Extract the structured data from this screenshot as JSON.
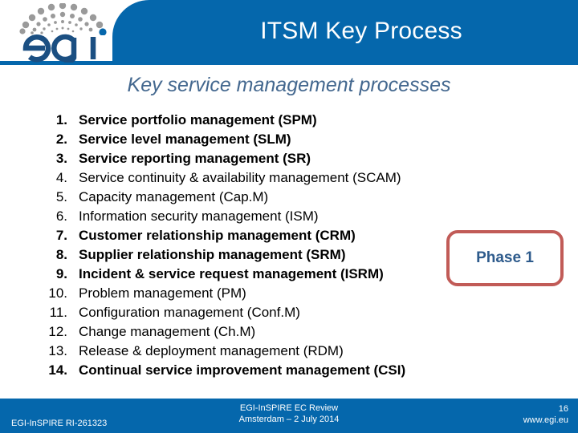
{
  "header": {
    "title": "ITSM Key Process",
    "logo_alt": "EGI",
    "logo_wordmark": "egi",
    "bar_color": "#0567ac"
  },
  "subtitle": "Key service management processes",
  "list": {
    "items": [
      {
        "num": "1.",
        "label": "Service portfolio management (SPM)",
        "bold": true
      },
      {
        "num": "2.",
        "label": "Service level management (SLM)",
        "bold": true
      },
      {
        "num": "3.",
        "label": "Service reporting management (SR)",
        "bold": true
      },
      {
        "num": "4.",
        "label": "Service continuity & availability management (SCAM)",
        "bold": false
      },
      {
        "num": "5.",
        "label": "Capacity management (Cap.M)",
        "bold": false
      },
      {
        "num": "6.",
        "label": "Information security management (ISM)",
        "bold": false
      },
      {
        "num": "7.",
        "label": "Customer relationship management (CRM)",
        "bold": true
      },
      {
        "num": "8.",
        "label": "Supplier relationship management (SRM)",
        "bold": true
      },
      {
        "num": "9.",
        "label": "Incident & service request management (ISRM)",
        "bold": true
      },
      {
        "num": "10.",
        "label": "Problem management (PM)",
        "bold": false
      },
      {
        "num": "11.",
        "label": "Configuration management (Conf.M)",
        "bold": false
      },
      {
        "num": "12.",
        "label": "Change management (Ch.M)",
        "bold": false
      },
      {
        "num": "13.",
        "label": "Release & deployment management (RDM)",
        "bold": false
      },
      {
        "num": "14.",
        "label": "Continual service improvement management (CSI)",
        "bold": true
      }
    ]
  },
  "phase_badge": {
    "label": "Phase 1",
    "border_color": "#c15b57",
    "text_color": "#2e5b8c"
  },
  "footer": {
    "left": "EGI-InSPIRE RI-261323",
    "center_line1": "EGI-InSPIRE EC Review",
    "center_line2": "Amsterdam – 2 July 2014",
    "slide_number": "16",
    "url": "www.egi.eu"
  }
}
